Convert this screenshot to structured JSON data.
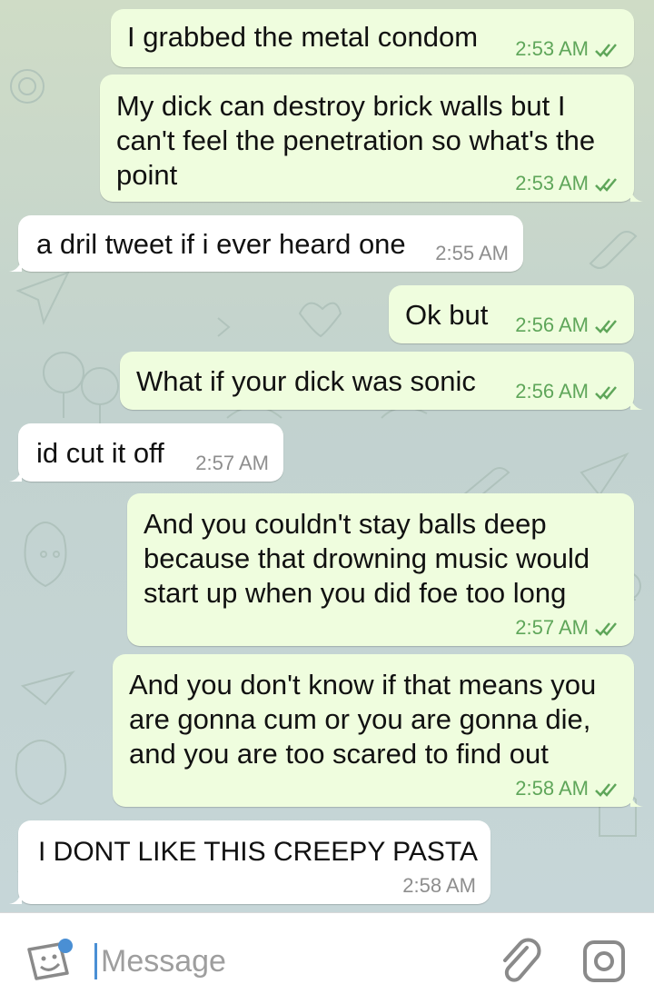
{
  "messages": [
    {
      "dir": "out",
      "lines": [
        "I grabbed the metal condom"
      ],
      "time": "2:53 AM",
      "read": true
    },
    {
      "dir": "out",
      "lines": [
        "My dick can destroy brick walls but I",
        "can't feel the penetration so what's the",
        "point"
      ],
      "time": "2:53 AM",
      "read": true
    },
    {
      "dir": "in",
      "lines": [
        "a dril tweet if i ever heard one"
      ],
      "time": "2:55 AM"
    },
    {
      "dir": "out",
      "lines": [
        "Ok but"
      ],
      "time": "2:56 AM",
      "read": true
    },
    {
      "dir": "out",
      "lines": [
        "What if your dick was sonic"
      ],
      "time": "2:56 AM",
      "read": true
    },
    {
      "dir": "in",
      "lines": [
        "id cut it off"
      ],
      "time": "2:57 AM"
    },
    {
      "dir": "out",
      "lines": [
        "And you couldn't stay balls deep",
        "because that drowning music would",
        "start up when you did foe too long"
      ],
      "time": "2:57 AM",
      "read": true
    },
    {
      "dir": "out",
      "lines": [
        "And you don't know if that means you",
        "are gonna cum or you are gonna die,",
        "and you are too scared to find out"
      ],
      "time": "2:58 AM",
      "read": true
    },
    {
      "dir": "in",
      "lines": [
        "I DONT LIKE THIS CREEPY PASTA"
      ],
      "time": "2:58 AM"
    }
  ],
  "composer": {
    "placeholder": "Message",
    "icons": [
      "sticker-icon",
      "paperclip-icon",
      "camera-icon"
    ]
  },
  "colors": {
    "outgoing": "#effdde",
    "incoming": "#ffffff",
    "read_check": "#5fa65a",
    "accent": "#4a8fd4"
  }
}
